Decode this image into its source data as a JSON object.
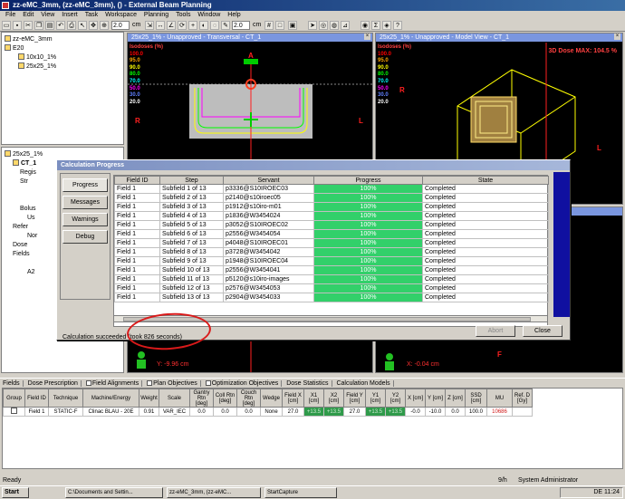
{
  "window": {
    "title": "zz-eMC_3mm, (zz-eMC_3mm), () - External Beam Planning"
  },
  "menu": [
    "File",
    "Edit",
    "View",
    "Insert",
    "Task",
    "Workspace",
    "Planning",
    "Tools",
    "Window",
    "Help"
  ],
  "toolbar": {
    "zoom_value": "2.0",
    "zoom_unit": "cm",
    "zoom_value2": "2.0",
    "zoom_unit2": "cm"
  },
  "tree_top": {
    "root": "zz-eMC_3mm",
    "course": "E20",
    "plan_a": "10x10_1%",
    "plan_b": "25x25_1%"
  },
  "tree_bottom": {
    "plan": "25x25_1%",
    "ct": "CT_1",
    "items": [
      "Regis",
      "Str",
      "Bolus",
      "Us",
      "Refer",
      "Nor",
      "Dose",
      "Fields",
      "A2"
    ]
  },
  "viewports": {
    "transversal_title": "25x25_1% - Unapproved - Transversal - CT_1",
    "model_title": "25x25_1% - Unapproved - Model View - CT_1",
    "iso_label": "Isodoses (%)",
    "iso_levels": [
      "100.0",
      "95.0",
      "90.0",
      "80.0",
      "70.0",
      "50.0",
      "30.0",
      "20.0"
    ],
    "iso_colors": [
      "#ff0000",
      "#ffa500",
      "#ffff00",
      "#00ff00",
      "#00ffff",
      "#ff00ff",
      "#0000ff",
      "#ffffff"
    ],
    "dose_max": "3D Dose MAX: 104.5 %",
    "orient_a": "A",
    "orient_r": "R",
    "orient_l": "L",
    "orient_f": "F",
    "coord_y": "Y: -9.96 cm",
    "coord_x": "X: -0.04 cm"
  },
  "dialog": {
    "title": "Calculation Progress",
    "side_buttons": [
      "Progress",
      "Messages",
      "Warnings",
      "Debug"
    ],
    "columns": [
      "Field ID",
      "Step",
      "Servant",
      "Progress",
      "State"
    ],
    "rows": [
      [
        "Field 1",
        "Subfield 1 of 13",
        "p3336@S10IROEC03",
        "100%",
        "Completed"
      ],
      [
        "Field 1",
        "Subfield 2 of 13",
        "p2140@s10iroec05",
        "100%",
        "Completed"
      ],
      [
        "Field 1",
        "Subfield 3 of 13",
        "p1912@s10iro-m01",
        "100%",
        "Completed"
      ],
      [
        "Field 1",
        "Subfield 4 of 13",
        "p1836@W3454024",
        "100%",
        "Completed"
      ],
      [
        "Field 1",
        "Subfield 5 of 13",
        "p3052@S10IROEC02",
        "100%",
        "Completed"
      ],
      [
        "Field 1",
        "Subfield 6 of 13",
        "p2556@W3454054",
        "100%",
        "Completed"
      ],
      [
        "Field 1",
        "Subfield 7 of 13",
        "p4048@S10IROEC01",
        "100%",
        "Completed"
      ],
      [
        "Field 1",
        "Subfield 8 of 13",
        "p3728@W3454042",
        "100%",
        "Completed"
      ],
      [
        "Field 1",
        "Subfield 9 of 13",
        "p1948@S10IROEC04",
        "100%",
        "Completed"
      ],
      [
        "Field 1",
        "Subfield 10 of 13",
        "p2556@W3454041",
        "100%",
        "Completed"
      ],
      [
        "Field 1",
        "Subfield 11 of 13",
        "p5120@s10iro-images",
        "100%",
        "Completed"
      ],
      [
        "Field 1",
        "Subfield 12 of 13",
        "p2576@W3454053",
        "100%",
        "Completed"
      ],
      [
        "Field 1",
        "Subfield 13 of 13",
        "p2904@W3454033",
        "100%",
        "Completed"
      ]
    ],
    "status": "Calculation succeeded (took 826 seconds)",
    "abort_label": "Abort",
    "close_label": "Close"
  },
  "bottom_tabs": [
    "Fields",
    "Dose Prescription",
    "Field Alignments",
    "Plan Objectives",
    "Optimization Objectives",
    "Dose Statistics",
    "Calculation Models"
  ],
  "fields_table": {
    "headers": [
      "Group",
      "Field ID",
      "Technique",
      "Machine/Energy",
      "Weight",
      "Scale",
      "Gantry Rtn [deg]",
      "Coll Rtn [deg]",
      "Couch Rtn [deg]",
      "Wedge",
      "Field X [cm]",
      "X1 [cm]",
      "X2 [cm]",
      "Field Y [cm]",
      "Y1 [cm]",
      "Y2 [cm]",
      "X [cm]",
      "Y [cm]",
      "Z [cm]",
      "SSD [cm]",
      "MU",
      "Ref. D [Gy]"
    ],
    "row": [
      "",
      "Field 1",
      "STATIC-F",
      "Clinac BLAU - 20E",
      "0.91",
      "VAR_IEC",
      "0.0",
      "0.0",
      "0.0",
      "None",
      "27.0",
      "+13.5",
      "+13.5",
      "27.0",
      "+13.5",
      "+13.5",
      "-0.0",
      "-10.0",
      "0.0",
      "100.0",
      "10686",
      ""
    ]
  },
  "statusbar": {
    "left": "Ready",
    "mode": "9/h",
    "user": "System Administrator"
  },
  "taskbar": {
    "start": "Start",
    "tasks": [
      "C:\\Documents and Settin...",
      "zz-eMC_3mm, (zz-eMC...",
      "StartCapture"
    ],
    "lang": "DE",
    "clock": "11:24"
  }
}
